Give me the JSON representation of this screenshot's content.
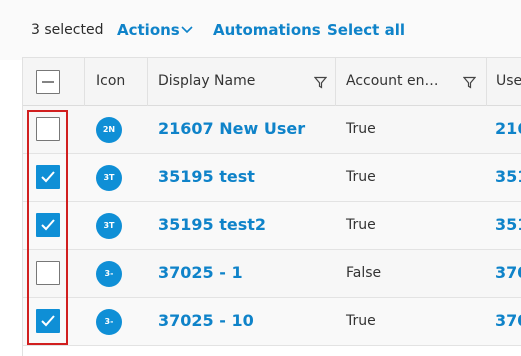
{
  "toolbar": {
    "selected_count": "3 selected",
    "actions_label": "Actions",
    "automations_label": "Automations",
    "select_all_label": "Select all"
  },
  "columns": {
    "icon": "Icon",
    "display_name": "Display Name",
    "account_enabled": "Account en…",
    "user": "Use"
  },
  "rows": [
    {
      "checked": false,
      "initials": "2N",
      "name": "21607 New User",
      "account_enabled": "True",
      "user": "216"
    },
    {
      "checked": true,
      "initials": "3T",
      "name": "35195 test",
      "account_enabled": "True",
      "user": "351"
    },
    {
      "checked": true,
      "initials": "3T",
      "name": "35195 test2",
      "account_enabled": "True",
      "user": "351"
    },
    {
      "checked": false,
      "initials": "3-",
      "name": "37025 - 1",
      "account_enabled": "False",
      "user": "370"
    },
    {
      "checked": true,
      "initials": "3-",
      "name": "37025 - 10",
      "account_enabled": "True",
      "user": "370"
    }
  ],
  "colors": {
    "accent": "#0f8fd6",
    "link": "#0f83c9",
    "highlight": "#d11f1f"
  }
}
